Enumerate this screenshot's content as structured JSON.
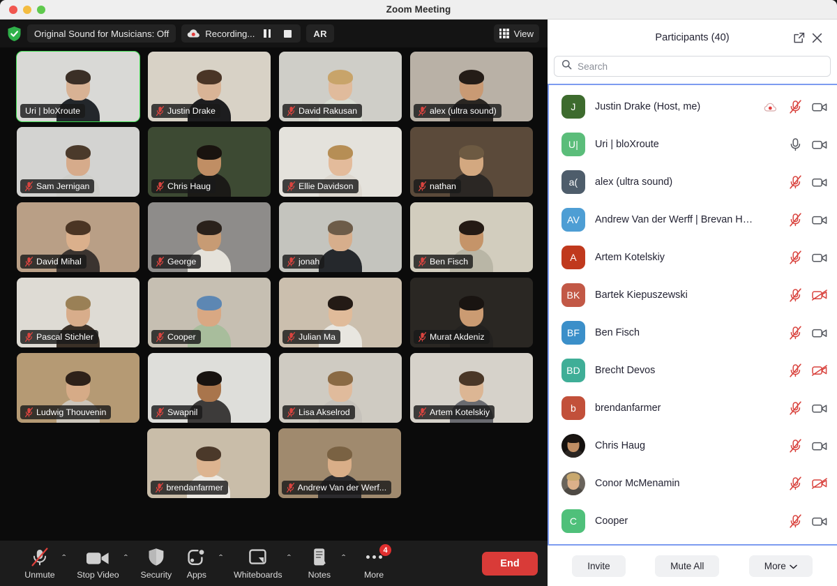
{
  "window": {
    "title": "Zoom Meeting",
    "traffic_lights": [
      "close-red",
      "minimize-yellow",
      "maximize-green"
    ]
  },
  "meeting_header": {
    "security_icon": "shield-check-icon",
    "original_sound_label": "Original Sound for Musicians: Off",
    "recording_label": "Recording...",
    "recording_icon": "recording-cloud-icon",
    "pause_recording_icon": "pause-icon",
    "stop_recording_icon": "stop-icon",
    "ar_label": "AR",
    "view_label": "View",
    "view_icon": "grid-icon"
  },
  "video_grid": {
    "rows": [
      [
        {
          "name": "Uri | bloXroute",
          "muted": false,
          "active_speaker": true,
          "bg": "#d9d9d6",
          "skin": "#d8b294",
          "hair": "#3b2f26",
          "shirt": "#23272b"
        },
        {
          "name": "Justin Drake",
          "muted": true,
          "active_speaker": false,
          "bg": "#d8d2c6",
          "skin": "#d9b496",
          "hair": "#4a3526",
          "shirt": "#1d1d1f"
        },
        {
          "name": "David Rakusan",
          "muted": true,
          "active_speaker": false,
          "bg": "#cfcec8",
          "skin": "#e0bb9c",
          "hair": "#c8a46a",
          "shirt": "#d8dcd2"
        },
        {
          "name": "alex (ultra sound)",
          "muted": true,
          "active_speaker": false,
          "bg": "#b9b1a6",
          "skin": "#c99a74",
          "hair": "#241c17",
          "shirt": "#2a2622"
        }
      ],
      [
        {
          "name": "Sam Jernigan",
          "muted": true,
          "active_speaker": false,
          "bg": "#d3d3d1",
          "skin": "#d6ab8b",
          "hair": "#4b3a2b",
          "shirt": "#cfcfcb"
        },
        {
          "name": "Chris Haug",
          "muted": true,
          "active_speaker": false,
          "bg": "#3d4a33",
          "skin": "#c08e64",
          "hair": "#19130f",
          "shirt": "#1b1a17"
        },
        {
          "name": "Ellie Davidson",
          "muted": true,
          "active_speaker": false,
          "bg": "#e4e2dc",
          "skin": "#e3bb9b",
          "hair": "#b68e55",
          "shirt": "#ddd8d0"
        },
        {
          "name": "nathan",
          "muted": true,
          "active_speaker": false,
          "bg": "#5b4a3a",
          "skin": "#d3a880",
          "hair": "#6d5a42",
          "shirt": "#2b2724"
        }
      ],
      [
        {
          "name": "David Mihal",
          "muted": true,
          "active_speaker": false,
          "bg": "#b99f86",
          "skin": "#dbb08c",
          "hair": "#4b3524",
          "shirt": "#3b3430"
        },
        {
          "name": "George",
          "muted": true,
          "active_speaker": false,
          "bg": "#8e8c8a",
          "skin": "#c79b74",
          "hair": "#2a211b",
          "shirt": "#e5e2da"
        },
        {
          "name": "jonah",
          "muted": true,
          "active_speaker": false,
          "bg": "#c4c4be",
          "skin": "#d7ae8c",
          "hair": "#6d5c49",
          "shirt": "#25282c"
        },
        {
          "name": "Ben Fisch",
          "muted": true,
          "active_speaker": false,
          "bg": "#d2cdbe",
          "skin": "#c59469",
          "hair": "#241a14",
          "shirt": "#b9b6a6"
        }
      ],
      [
        {
          "name": "Pascal Stichler",
          "muted": true,
          "active_speaker": false,
          "bg": "#dedbd4",
          "skin": "#d8ad8b",
          "hair": "#9a8056",
          "shirt": "#3a3027"
        },
        {
          "name": "Cooper",
          "muted": true,
          "active_speaker": false,
          "bg": "#c6bfb2",
          "skin": "#d9a883",
          "hair": "#5d87b3",
          "shirt": "#a8bd9c"
        },
        {
          "name": "Julian Ma",
          "muted": true,
          "active_speaker": false,
          "bg": "#cbbfae",
          "skin": "#e0bb9a",
          "hair": "#231a15",
          "shirt": "#e8e6e0"
        },
        {
          "name": "Murat Akdeniz",
          "muted": true,
          "active_speaker": false,
          "bg": "#2a2723",
          "skin": "#cb9b72",
          "hair": "#191411",
          "shirt": "#23211f"
        }
      ],
      [
        {
          "name": "Ludwig Thouvenin",
          "muted": true,
          "active_speaker": false,
          "bg": "#b59a74",
          "skin": "#d6ab87",
          "hair": "#2e2119",
          "shirt": "#cdc6bb"
        },
        {
          "name": "Swapnil",
          "muted": true,
          "active_speaker": false,
          "bg": "#dededa",
          "skin": "#a9754c",
          "hair": "#181310",
          "shirt": "#3d3b3a"
        },
        {
          "name": "Lisa Akselrod",
          "muted": true,
          "active_speaker": false,
          "bg": "#cfcbc2",
          "skin": "#e0bb9c",
          "hair": "#8a6a44",
          "shirt": "#c6c2bb"
        },
        {
          "name": "Artem Kotelskiy",
          "muted": true,
          "active_speaker": false,
          "bg": "#d6d2ca",
          "skin": "#dcb694",
          "hair": "#4a3727",
          "shirt": "#6a6b70"
        }
      ],
      [
        {
          "name": "brendanfarmer",
          "muted": true,
          "active_speaker": false,
          "bg": "#c9bda9",
          "skin": "#ddb490",
          "hair": "#4b392a",
          "shirt": "#ece9e3"
        },
        {
          "name": "Andrew Van der Werf...",
          "muted": true,
          "active_speaker": false,
          "bg": "#a08a6e",
          "skin": "#d9ae88",
          "hair": "#7a6243",
          "shirt": "#2c2b2e"
        }
      ]
    ]
  },
  "meeting_toolbar": {
    "buttons": [
      {
        "label": "Unmute",
        "icon": "microphone-off-icon",
        "has_caret": true,
        "badge": null
      },
      {
        "label": "Stop Video",
        "icon": "video-camera-icon",
        "has_caret": true,
        "badge": null
      },
      {
        "label": "Security",
        "icon": "shield-icon",
        "has_caret": false,
        "badge": null
      },
      {
        "label": "Apps",
        "icon": "apps-icon",
        "has_caret": true,
        "badge": null
      },
      {
        "label": "Whiteboards",
        "icon": "whiteboard-icon",
        "has_caret": true,
        "badge": null
      },
      {
        "label": "Notes",
        "icon": "notes-icon",
        "has_caret": true,
        "badge": null
      },
      {
        "label": "More",
        "icon": "ellipsis-icon",
        "has_caret": false,
        "badge": "4"
      }
    ],
    "end_label": "End"
  },
  "participants_panel": {
    "title": "Participants (40)",
    "popout_icon": "popout-icon",
    "close_icon": "close-icon",
    "search": {
      "placeholder": "Search",
      "value": "",
      "icon": "search-icon"
    },
    "rows": [
      {
        "name": "Justin Drake (Host, me)",
        "initials": "J",
        "avatar_color": "#3d6b2e",
        "avatar_type": "initials",
        "recording": true,
        "mic": "muted",
        "video": "on"
      },
      {
        "name": "Uri | bloXroute",
        "initials": "U|",
        "avatar_color": "#5bbd7a",
        "avatar_type": "initials",
        "recording": false,
        "mic": "unmuted",
        "video": "on"
      },
      {
        "name": "alex (ultra sound)",
        "initials": "a(",
        "avatar_color": "#4e5d6b",
        "avatar_type": "initials",
        "recording": false,
        "mic": "muted",
        "video": "on"
      },
      {
        "name": "Andrew Van der Werff | Brevan Howard",
        "initials": "AV",
        "avatar_color": "#4e9ed4",
        "avatar_type": "initials",
        "recording": false,
        "mic": "muted",
        "video": "on"
      },
      {
        "name": "Artem Kotelskiy",
        "initials": "A",
        "avatar_color": "#c0391d",
        "avatar_type": "initials",
        "recording": false,
        "mic": "muted",
        "video": "on"
      },
      {
        "name": "Bartek Kiepuszewski",
        "initials": "BK",
        "avatar_color": "#c25846",
        "avatar_type": "initials",
        "recording": false,
        "mic": "muted",
        "video": "off"
      },
      {
        "name": "Ben Fisch",
        "initials": "BF",
        "avatar_color": "#3b8fc9",
        "avatar_type": "initials",
        "recording": false,
        "mic": "muted",
        "video": "on"
      },
      {
        "name": "Brecht Devos",
        "initials": "BD",
        "avatar_color": "#3fae97",
        "avatar_type": "initials",
        "recording": false,
        "mic": "muted",
        "video": "off"
      },
      {
        "name": "brendanfarmer",
        "initials": "b",
        "avatar_color": "#c2503a",
        "avatar_type": "initials",
        "recording": false,
        "mic": "muted",
        "video": "on"
      },
      {
        "name": "Chris Haug",
        "initials": "",
        "avatar_color": "#14110f",
        "avatar_type": "photo",
        "photo_skin": "#c08e64",
        "photo_hair": "#1b1512",
        "photo_shirt": "#2a2522",
        "recording": false,
        "mic": "muted",
        "video": "on"
      },
      {
        "name": "Conor McMenamin",
        "initials": "",
        "avatar_color": "#6a645c",
        "avatar_type": "photo",
        "photo_skin": "#dcb08a",
        "photo_hair": "#c8a86e",
        "photo_shirt": "#4e4a44",
        "recording": false,
        "mic": "muted",
        "video": "off"
      },
      {
        "name": "Cooper",
        "initials": "C",
        "avatar_color": "#4fc07a",
        "avatar_type": "initials",
        "recording": false,
        "mic": "muted",
        "video": "on"
      }
    ],
    "footer": {
      "invite_label": "Invite",
      "mute_all_label": "Mute All",
      "more_label": "More",
      "more_caret_icon": "chevron-down-icon"
    }
  },
  "colors": {
    "accent_green": "#3ddc50",
    "end_red": "#d93b38",
    "mute_red": "#d9443f",
    "focus_blue": "#7d9bf0"
  }
}
